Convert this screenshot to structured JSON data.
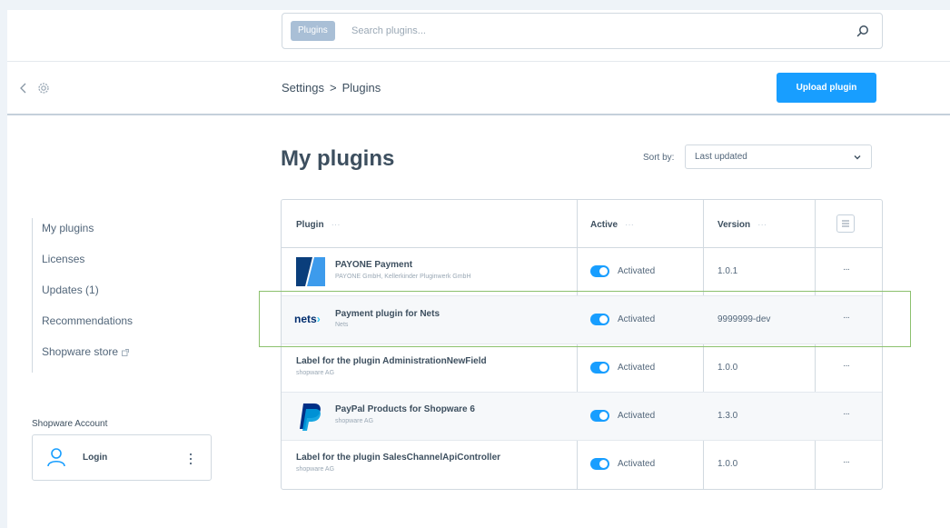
{
  "search": {
    "tag": "Plugins",
    "placeholder": "Search plugins..."
  },
  "header": {
    "breadcrumb": [
      "Settings",
      ">",
      "Plugins"
    ],
    "upload_label": "Upload plugin"
  },
  "main": {
    "title": "My plugins",
    "sort_label": "Sort by:",
    "sort_value": "Last updated"
  },
  "sidebar": {
    "items": [
      {
        "label": "My plugins"
      },
      {
        "label": "Licenses"
      },
      {
        "label": "Updates (1)"
      },
      {
        "label": "Recommendations"
      },
      {
        "label": "Shopware store"
      }
    ],
    "account_label": "Shopware Account",
    "login_label": "Login"
  },
  "table": {
    "columns": {
      "plugin": "Plugin",
      "active": "Active",
      "version": "Version",
      "dots": "···"
    },
    "rows": [
      {
        "name": "PAYONE Payment",
        "vendor": "PAYONE GmbH, Kellerkinder Pluginwerk GmbH",
        "active": "Activated",
        "version": "1.0.1",
        "menu": "···",
        "logo": "payone-logo"
      },
      {
        "name": "Payment plugin for Nets",
        "vendor": "Nets",
        "active": "Activated",
        "version": "9999999-dev",
        "menu": "···",
        "logo": "nets-logo",
        "logo_text": "nets"
      },
      {
        "name": "Label for the plugin AdministrationNewField",
        "vendor": "shopware AG",
        "active": "Activated",
        "version": "1.0.0",
        "menu": "···"
      },
      {
        "name": "PayPal Products for Shopware 6",
        "vendor": "shopware AG",
        "active": "Activated",
        "version": "1.3.0",
        "menu": "···",
        "logo": "paypal-logo"
      },
      {
        "name": "Label for the plugin SalesChannelApiController",
        "vendor": "shopware AG",
        "active": "Activated",
        "version": "1.0.0",
        "menu": "···"
      }
    ]
  },
  "colors": {
    "accent": "#189eff",
    "highlight": "#8cc16e"
  }
}
